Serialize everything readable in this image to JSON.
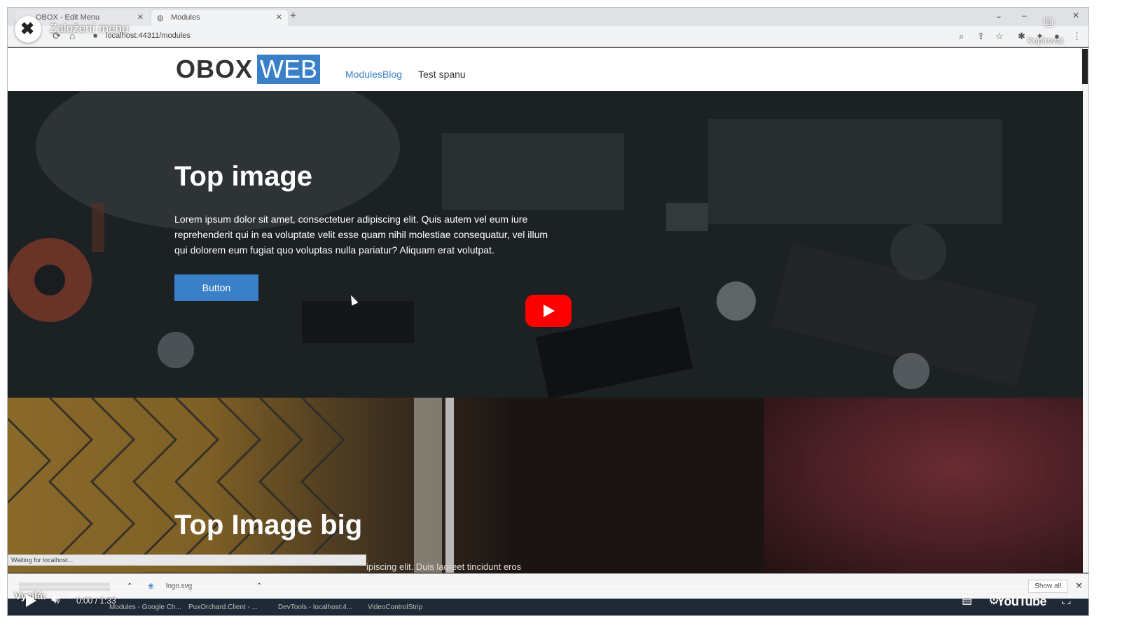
{
  "overlay": {
    "title": "Založení menu",
    "copy_label": "Kopírovat",
    "logo_icon": "close-x-icon"
  },
  "browser": {
    "tabs": [
      {
        "label": "OBOX - Edit Menu"
      },
      {
        "label": "Modules"
      }
    ],
    "url": "localhost:44311/modules"
  },
  "site": {
    "logo_left": "OBOX",
    "logo_right": "WEB",
    "nav": [
      "Modules",
      "Blog",
      "Test spanu"
    ]
  },
  "hero": {
    "title": "Top image",
    "text": "Lorem ipsum dolor sit amet, consectetuer adipiscing elit. Quis autem vel eum iure reprehenderit qui in ea voluptate velit esse quam nihil molestiae consequatur, vel illum qui dolorem eum fugiat quo voluptas nulla pariatur? Aliquam erat volutpat.",
    "button": "Button"
  },
  "hero2": {
    "title": "Top Image big",
    "sub": "ipiscing elit. Duis laoreet tincidunt eros"
  },
  "status": "Waiting for localhost...",
  "downloads": {
    "items": [
      "logo.svg"
    ],
    "show_all": "Show all"
  },
  "taskbar": {
    "items": [
      "Modules - Google Ch...",
      "PuxOrchard.Client - ...",
      "DevTools - localhost:4...",
      "VideoControlStrip"
    ]
  },
  "player": {
    "time": "0:00 / 1:33",
    "broadcast_label": "Vysílá:",
    "broadcast_logo": "YouTube",
    "brand": "YouTube",
    "play_color": "#ff0000"
  }
}
